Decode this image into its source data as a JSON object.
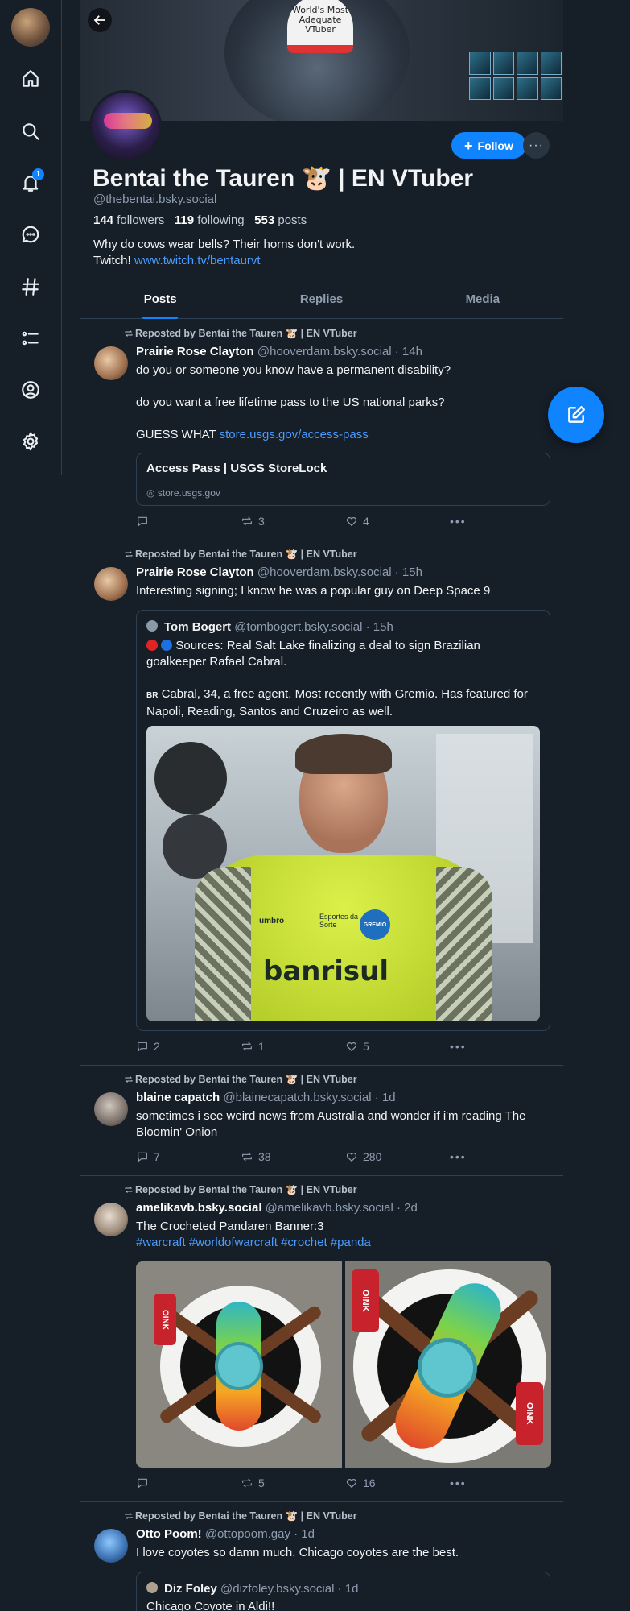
{
  "profile": {
    "display_name": "Bentai the Tauren 🐮 | EN VTuber",
    "handle": "@thebentai.bsky.social",
    "followers_count": "144",
    "followers_label": "followers",
    "following_count": "119",
    "following_label": "following",
    "posts_count": "553",
    "posts_label": "posts",
    "bio_line1": "Why do cows wear bells? Their horns don't work.",
    "bio_prefix": "Twitch! ",
    "bio_link": "www.twitch.tv/bentaurvt",
    "follow_label": "Follow",
    "banner_hat_text": "World's Most Adequate VTuber",
    "notification_badge": "1"
  },
  "tabs": [
    "Posts",
    "Replies",
    "Media"
  ],
  "repost_label": "Reposted by Bentai the Tauren 🐮 | EN VTuber",
  "posts": [
    {
      "author": "Prairie Rose Clayton",
      "handle": "@hooverdam.bsky.social",
      "time": "· 14h",
      "text1": "do you or someone you know have a permanent disability?",
      "text2": "do you want a free lifetime pass to the US national parks?",
      "text3_prefix": "GUESS WHAT ",
      "text3_link": "store.usgs.gov/access-pass",
      "card_title": "Access Pass | USGS StoreLock",
      "card_domain": "store.usgs.gov",
      "replies": "",
      "reposts": "3",
      "likes": "4"
    },
    {
      "author": "Prairie Rose Clayton",
      "handle": "@hooverdam.bsky.social",
      "time": "· 15h",
      "text": "Interesting signing; I know he was a popular guy on Deep Space 9",
      "quote_author": "Tom Bogert",
      "quote_handle": "@tombogert.bsky.social",
      "quote_time": "· 15h",
      "quote_text1": "Sources: Real Salt Lake finalizing a deal to sign Brazilian goalkeeper Rafael Cabral.",
      "quote_flag": "BR",
      "quote_text2": "Cabral, 34, a free agent. Most recently with Gremio. Has featured for Napoli, Reading, Santos and Cruzeiro as well.",
      "shirt_sponsor": "banrisul",
      "shirt_brand": "umbro",
      "shirt_sub": "Esportes da Sorte",
      "shirt_crest": "GREMIO",
      "replies": "2",
      "reposts": "1",
      "likes": "5"
    },
    {
      "author": "blaine capatch",
      "handle": "@blainecapatch.bsky.social",
      "time": "· 1d",
      "text": "sometimes i see weird news from Australia and wonder if i'm reading The Bloomin' Onion",
      "replies": "7",
      "reposts": "38",
      "likes": "280"
    },
    {
      "author": "amelikavb.bsky.social",
      "handle": "@amelikavb.bsky.social",
      "time": "· 2d",
      "text": "The Crocheted Pandaren Banner:3",
      "tags": [
        "#warcraft",
        "#worldofwarcraft",
        "#crochet",
        "#panda"
      ],
      "banner_tag": "OINK",
      "replies": "",
      "reposts": "5",
      "likes": "16"
    },
    {
      "author": "Otto Poom!",
      "handle": "@ottopoom.gay",
      "time": "· 1d",
      "text": "I love coyotes so damn much. Chicago coyotes are the best.",
      "quote_author": "Diz Foley",
      "quote_handle": "@dizfoley.bsky.social",
      "quote_time": "· 1d",
      "quote_text": "Chicago Coyote in Aldi!!"
    }
  ]
}
